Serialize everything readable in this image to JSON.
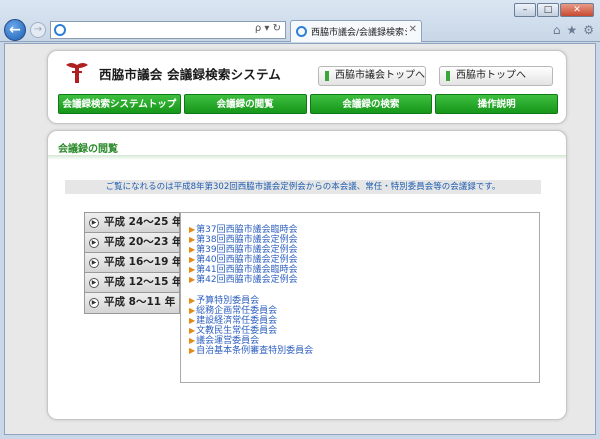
{
  "browser": {
    "address": "",
    "address_tools": "ρ ▾ ↻",
    "tab_title": "西脇市議会/会議録検索シ...",
    "tab_close": "✕",
    "tools": [
      "⌂",
      "★",
      "⚙"
    ],
    "window_buttons": [
      "–",
      "□",
      "✕"
    ]
  },
  "header": {
    "site_title": "西脇市議会  会議録検索システム",
    "links": [
      "西脇市議会トップへ",
      "西脇市トップへ"
    ]
  },
  "nav": [
    "会議録検索システムトップ",
    "会議録の閲覧",
    "会議録の検索",
    "操作説明"
  ],
  "main": {
    "section_title": "会議録の閲覧",
    "notice": "ご覧になれるのは平成8年第302回西脇市議会定例会からの本会議、常任・特別委員会等の会議録です。",
    "eras": [
      "平成 24～25 年",
      "平成 20～23 年",
      "平成 16～19 年",
      "平成 12～15 年",
      "平成  8～11 年"
    ],
    "sessions": [
      "第37回西脇市議会臨時会",
      "第38回西脇市議会定例会",
      "第39回西脇市議会定例会",
      "第40回西脇市議会定例会",
      "第41回西脇市議会臨時会",
      "第42回西脇市議会定例会"
    ],
    "committees": [
      "予算特別委員会",
      "総務企画常任委員会",
      "建設経済常任委員会",
      "文教民生常任委員会",
      "議会運営委員会",
      "自治基本条例審査特別委員会"
    ]
  },
  "colors": {
    "nav_green": "#15961a",
    "link_blue": "#2c5fbf",
    "arrow_orange": "#e38a17",
    "section_green": "#2d8a2d"
  }
}
